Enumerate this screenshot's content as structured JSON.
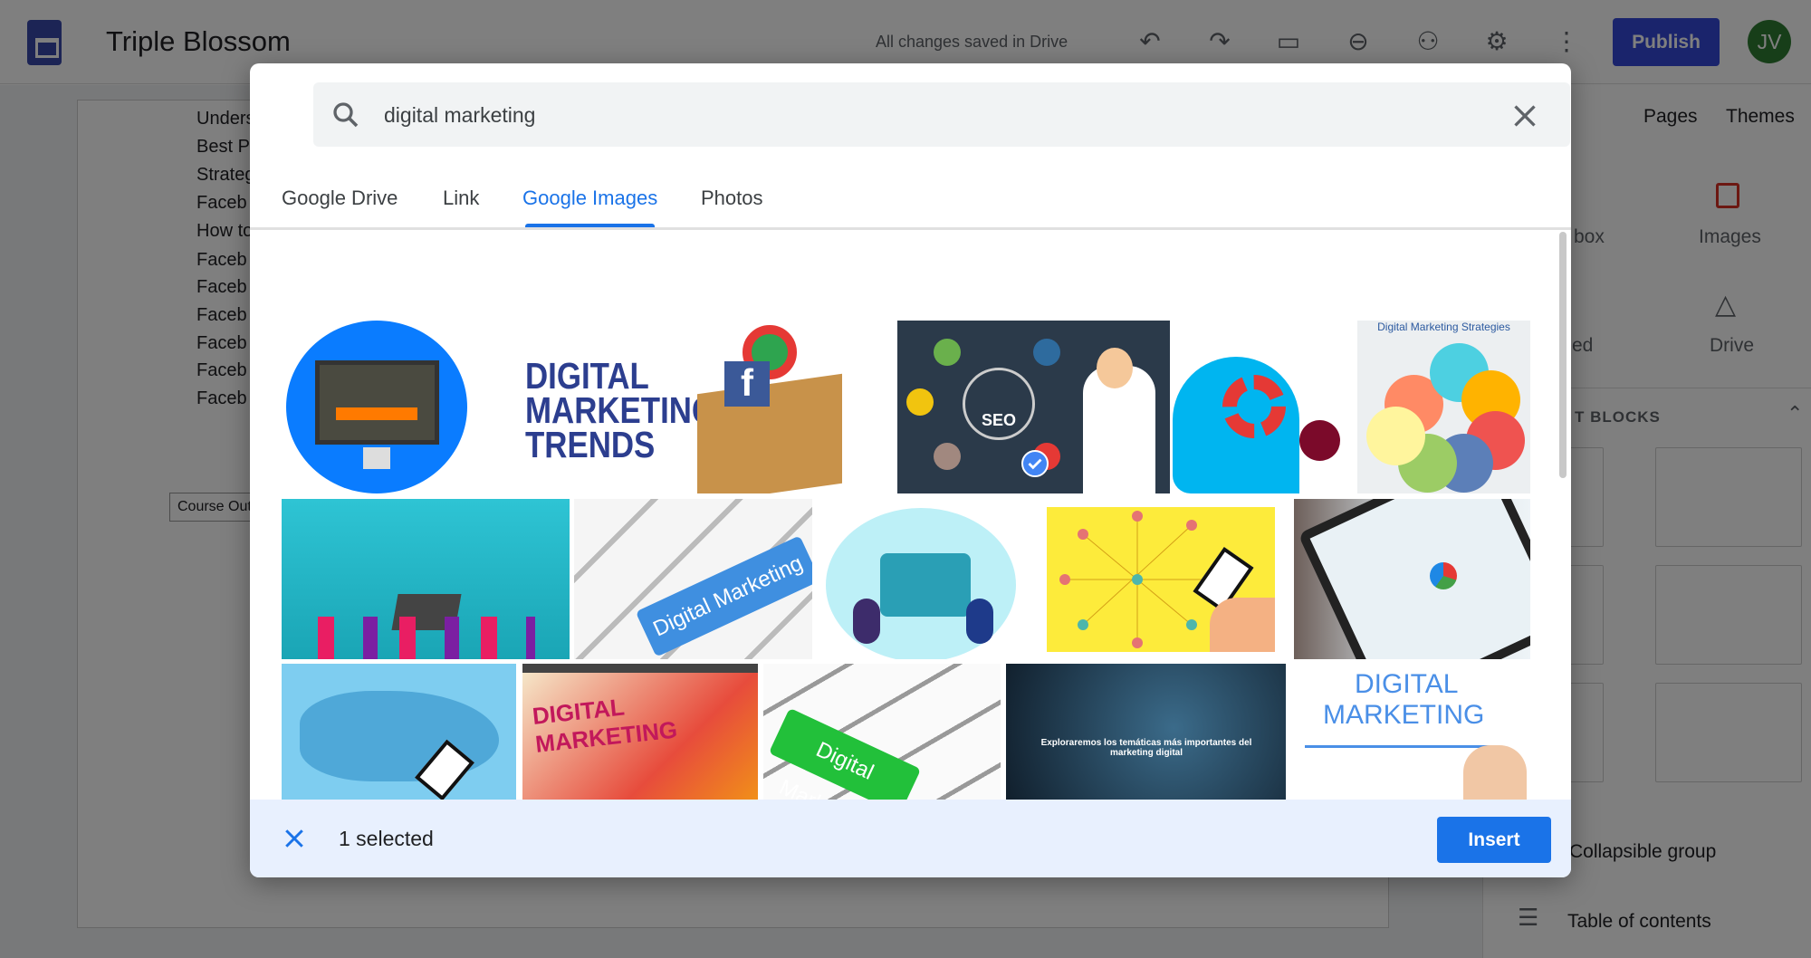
{
  "header": {
    "title": "Triple Blossom",
    "save_status": "All changes saved in Drive",
    "publish_label": "Publish",
    "avatar_initials": "JV",
    "icons": [
      "undo-icon",
      "redo-icon",
      "preview-icon",
      "link-icon",
      "share-icon",
      "gear-icon",
      "more-vert-icon"
    ]
  },
  "document": {
    "lines": [
      "Unders",
      "Best P",
      "Strateg",
      "Faceb",
      "How to",
      "Faceb",
      "Faceb",
      "Faceb",
      "Faceb",
      "Faceb",
      "Faceb"
    ],
    "button_label": "Course Out"
  },
  "panel": {
    "tabs": [
      "Pages",
      "Themes"
    ],
    "insert_items": [
      "box",
      "Images",
      "ed",
      "Drive"
    ],
    "section_label": "T BLOCKS",
    "items": [
      "Collapsible group",
      "Table of contents"
    ]
  },
  "dialog": {
    "search": {
      "value": "digital marketing"
    },
    "tabs": [
      {
        "label": "Google Drive"
      },
      {
        "label": "Link"
      },
      {
        "label": "Google Images",
        "active": true
      },
      {
        "label": "Photos"
      }
    ],
    "images": {
      "dmt": "DIGITAL MARKETING TRENDS",
      "seo": "SEO",
      "strategies": "Digital Marketing Strategies",
      "keyboard": "Digital Marketing",
      "tablet": "DIGITAL MARKETING",
      "keyboard2": "Digital Marketing",
      "dark": "Exploraremos los temáticas más importantes del marketing digital",
      "hand1": "DIGITAL",
      "hand2": "MARKETING"
    },
    "selected_image": "yellow-network-phone",
    "footer": {
      "selected_text": "1 selected",
      "insert_label": "Insert"
    }
  },
  "colors": {
    "accent": "#1a73e8",
    "publish": "#3449d8",
    "footer_bg": "#e8f0fe"
  }
}
